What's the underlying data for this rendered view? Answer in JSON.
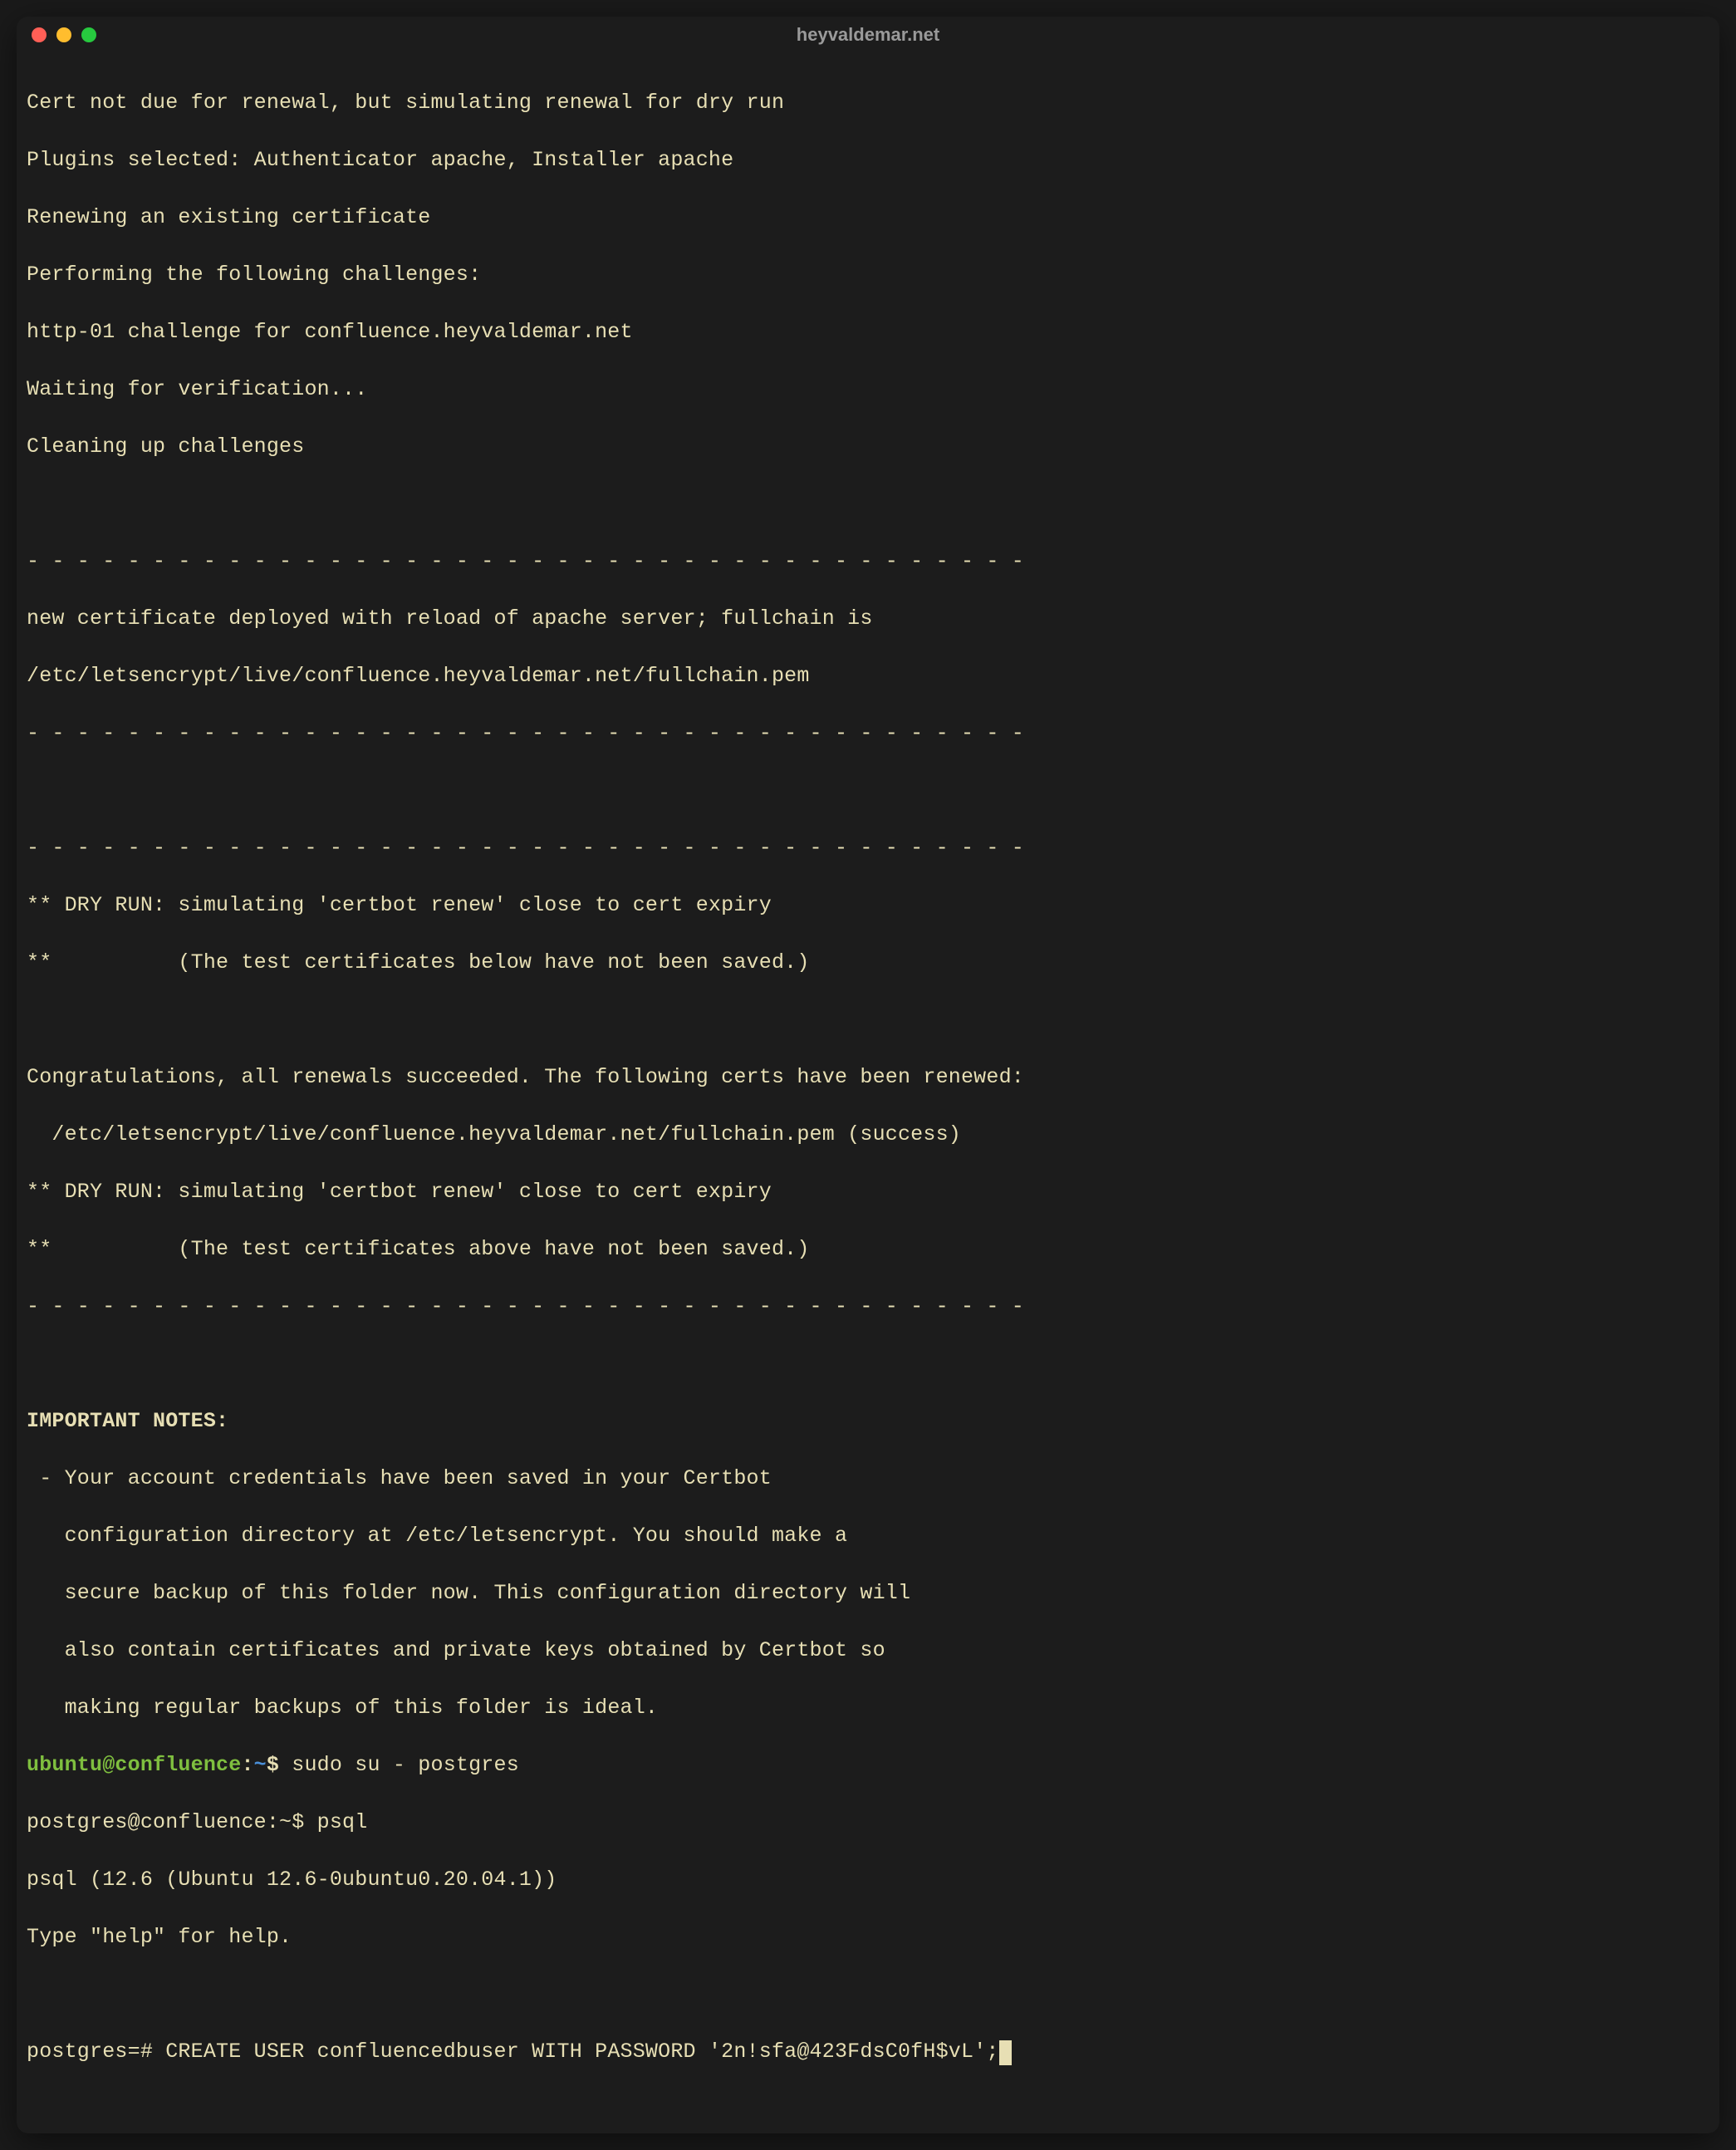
{
  "window": {
    "title": "heyvaldemar.net"
  },
  "terminal": {
    "lines": [
      "Cert not due for renewal, but simulating renewal for dry run",
      "Plugins selected: Authenticator apache, Installer apache",
      "Renewing an existing certificate",
      "Performing the following challenges:",
      "http-01 challenge for confluence.heyvaldemar.net",
      "Waiting for verification...",
      "Cleaning up challenges",
      "",
      "- - - - - - - - - - - - - - - - - - - - - - - - - - - - - - - - - - - - - - - -",
      "new certificate deployed with reload of apache server; fullchain is",
      "/etc/letsencrypt/live/confluence.heyvaldemar.net/fullchain.pem",
      "- - - - - - - - - - - - - - - - - - - - - - - - - - - - - - - - - - - - - - - -",
      "",
      "- - - - - - - - - - - - - - - - - - - - - - - - - - - - - - - - - - - - - - - -",
      "** DRY RUN: simulating 'certbot renew' close to cert expiry",
      "**          (The test certificates below have not been saved.)",
      "",
      "Congratulations, all renewals succeeded. The following certs have been renewed:",
      "  /etc/letsencrypt/live/confluence.heyvaldemar.net/fullchain.pem (success)",
      "** DRY RUN: simulating 'certbot renew' close to cert expiry",
      "**          (The test certificates above have not been saved.)",
      "- - - - - - - - - - - - - - - - - - - - - - - - - - - - - - - - - - - - - - - -",
      ""
    ],
    "notes_header": "IMPORTANT NOTES:",
    "notes_lines": [
      " - Your account credentials have been saved in your Certbot",
      "   configuration directory at /etc/letsencrypt. You should make a",
      "   secure backup of this folder now. This configuration directory will",
      "   also contain certificates and private keys obtained by Certbot so",
      "   making regular backups of this folder is ideal."
    ],
    "prompt1": {
      "user": "ubuntu@confluence",
      "sep": ":",
      "path": "~",
      "dollar": "$ ",
      "cmd": "sudo su - postgres"
    },
    "line_postgres_prompt": "postgres@confluence:~$ psql",
    "line_psql_version": "psql (12.6 (Ubuntu 12.6-0ubuntu0.20.04.1))",
    "line_psql_help": "Type \"help\" for help.",
    "blank": "",
    "psql_prompt": "postgres=# ",
    "psql_cmd": "CREATE USER confluencedbuser WITH PASSWORD '2n!sfa@423FdsC0fH$vL';"
  }
}
